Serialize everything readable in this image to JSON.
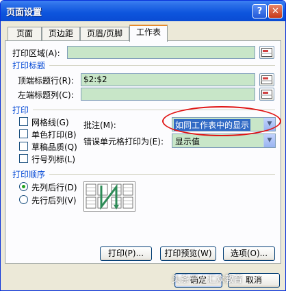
{
  "window": {
    "title": "页面设置",
    "help_button": "?",
    "close_button": "✕"
  },
  "tabs": [
    {
      "label": "页面",
      "active": false
    },
    {
      "label": "页边距",
      "active": false
    },
    {
      "label": "页眉/页脚",
      "active": false
    },
    {
      "label": "工作表",
      "active": true
    }
  ],
  "print_area": {
    "label": "打印区域(A):",
    "value": ""
  },
  "print_titles": {
    "section": "打印标题",
    "top_rows": {
      "label": "顶端标题行(R):",
      "value": "$2:$2"
    },
    "left_columns": {
      "label": "左端标题列(C):",
      "value": ""
    }
  },
  "print": {
    "section": "打印",
    "checkboxes": [
      {
        "label": "网格线(G)",
        "checked": false
      },
      {
        "label": "单色打印(B)",
        "checked": false
      },
      {
        "label": "草稿品质(Q)",
        "checked": false
      },
      {
        "label": "行号列标(L)",
        "checked": false
      }
    ],
    "comments": {
      "label": "批注(M):",
      "value": "如同工作表中的显示"
    },
    "errors": {
      "label": "错误单元格打印为(E):",
      "value": "显示值"
    }
  },
  "page_order": {
    "section": "打印顺序",
    "options": [
      {
        "label": "先列后行(D)",
        "selected": true
      },
      {
        "label": "先行后列(V)",
        "selected": false
      }
    ]
  },
  "buttons": {
    "print": "打印(P)...",
    "preview": "打印预览(W)",
    "options": "选项(O)...",
    "ok": "确定",
    "cancel": "取消"
  },
  "watermark": "头条号 / 汇众教育",
  "colors": {
    "titlebar": "#0a4bd3",
    "section_text": "#0046d5",
    "field_bg": "#c8e6c8",
    "highlight_ellipse": "#e01515"
  }
}
